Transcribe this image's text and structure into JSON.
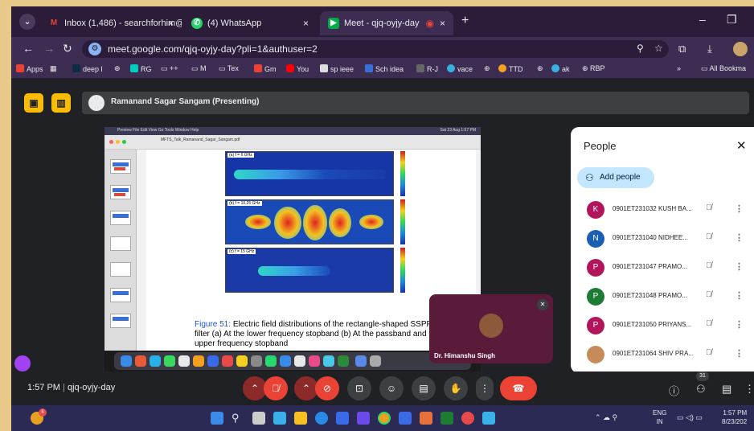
{
  "browser": {
    "tabs": [
      {
        "title": "Inbox (1,486) - searchforhim@c",
        "icon": "gmail-icon",
        "color": "#ea4335"
      },
      {
        "title": "(4) WhatsApp",
        "icon": "whatsapp-icon",
        "color": "#25d366"
      },
      {
        "title": "Meet - qjq-oyjy-day",
        "icon": "meet-icon",
        "color": "#00ac47",
        "active": true
      }
    ],
    "url": "meet.google.com/qjq-oyjy-day?pli=1&authuser=2",
    "bookmarks": [
      "Apps",
      "deep l",
      "RG",
      "++",
      "M",
      "Tex",
      "Gm",
      "You",
      "sp ieee",
      "Sch idea",
      "R-J",
      "vace",
      "TTD",
      "ak",
      "RBP",
      "All Bookma"
    ],
    "bookmark_overflow": "»"
  },
  "meet": {
    "presenter_label": "Ramanand Sagar Sangam (Presenting)",
    "meeting_code": "qjq-oyjy-day",
    "time": "1:57 PM",
    "self_name": "Dr. Himanshu Singh",
    "participant_count": "31",
    "people_panel": {
      "title": "People",
      "add_label": "Add people",
      "participants": [
        {
          "initial": "K",
          "name": "0901ET231032 KUSH BA...",
          "color": "#b3155a"
        },
        {
          "initial": "N",
          "name": "0901ET231040 NIDHEE...",
          "color": "#1a5fb4"
        },
        {
          "initial": "P",
          "name": "0901ET231047 PRAMO...",
          "color": "#b3155a"
        },
        {
          "initial": "P",
          "name": "0901ET231048 PRAMO...",
          "color": "#1e7b34"
        },
        {
          "initial": "P",
          "name": "0901ET231050 PRIYANS...",
          "color": "#b3155a"
        },
        {
          "initial": "",
          "name": "0901ET231064 SHIV PRA...",
          "color": "#c78b5a"
        }
      ]
    }
  },
  "shared_screen": {
    "pdf_title": "MFTS_Talk_Ramanand_Sagar_Sangam.pdf",
    "panels": [
      "(a) f = 6 GHz",
      "(b) f = 10.25 GHz",
      "(c) f = 15 GHz"
    ],
    "caption_prefix": "Figure 51:",
    "caption_text": "Electric field distributions of the rectangle-shaped SSPP-SIW b filter (a) At the lower frequency stopband (b) At the passband and (c) At upper frequency stopband",
    "mac_menu": "Preview  File  Edit  View  Go  Tools  Window  Help",
    "mac_time": "Sat 23 Aug 1:57 PM"
  },
  "system": {
    "lang_line1": "ENG",
    "lang_line2": "IN",
    "clock_time": "1:57 PM",
    "clock_date": "8/23/202",
    "notif_badge": "6"
  }
}
